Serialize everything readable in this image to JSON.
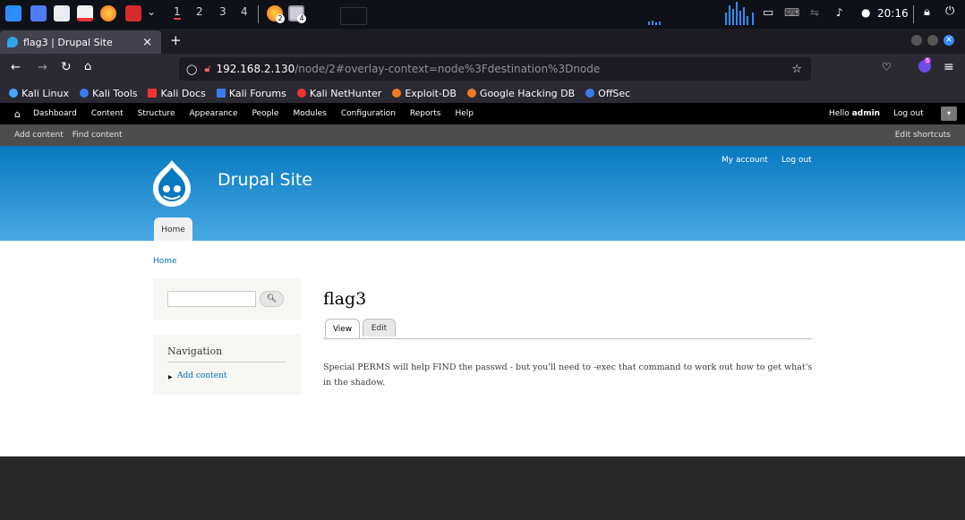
{
  "taskbar": {
    "workspaces": [
      "1",
      "2",
      "3",
      "4"
    ],
    "badges": [
      "2",
      "4"
    ],
    "clock": "20:16"
  },
  "browser": {
    "tab_title": "flag3 | Drupal Site",
    "tab_close": "×",
    "new_tab": "+",
    "url_host": "192.168.2.130",
    "url_path": "/node/2#overlay-context=node%3Fdestination%3Dnode",
    "ext_badge": "6",
    "bookmarks": [
      "Kali Linux",
      "Kali Tools",
      "Kali Docs",
      "Kali Forums",
      "Kali NetHunter",
      "Exploit-DB",
      "Google Hacking DB",
      "OffSec"
    ]
  },
  "toolbar": {
    "items": [
      "Dashboard",
      "Content",
      "Structure",
      "Appearance",
      "People",
      "Modules",
      "Configuration",
      "Reports",
      "Help"
    ],
    "hello": "Hello ",
    "user": "admin",
    "logout": "Log out"
  },
  "shortcuts": {
    "items": [
      "Add content",
      "Find content"
    ],
    "edit": "Edit shortcuts"
  },
  "header": {
    "site_name": "Drupal Site",
    "my_account": "My account",
    "log_out": "Log out",
    "home_tab": "Home"
  },
  "main": {
    "breadcrumb": "Home",
    "title": "flag3",
    "tabs": [
      "View",
      "Edit"
    ],
    "body": "Special PERMS will help FIND the passwd - but you'll need to -exec that command to work out how to get what's in the shadow.",
    "nav_title": "Navigation",
    "nav_item": "Add content"
  },
  "colors": {
    "accent": "#0071b3",
    "header_top": "#0779bf",
    "header_bottom": "#48a9e4"
  }
}
